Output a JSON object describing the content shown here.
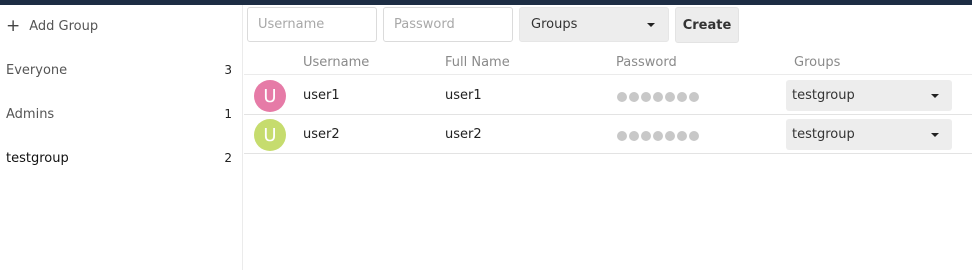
{
  "sidebar": {
    "add_group_icon": "+",
    "add_group_label": "Add Group",
    "groups": [
      {
        "name": "Everyone",
        "count": "3"
      },
      {
        "name": "Admins",
        "count": "1"
      },
      {
        "name": "testgroup",
        "count": "2"
      }
    ]
  },
  "toolbar": {
    "username_placeholder": "Username",
    "password_placeholder": "Password",
    "groups_select": "Groups",
    "create_label": "Create"
  },
  "table": {
    "headers": {
      "username": "Username",
      "fullname": "Full Name",
      "password": "Password",
      "groups": "Groups"
    },
    "rows": [
      {
        "avatar_letter": "U",
        "avatar_color": "#e67ba7",
        "username": "user1",
        "fullname": "user1",
        "password_dots": 7,
        "groups": "testgroup"
      },
      {
        "avatar_letter": "U",
        "avatar_color": "#c6dc6e",
        "username": "user2",
        "fullname": "user2",
        "password_dots": 7,
        "groups": "testgroup"
      }
    ]
  },
  "colors": {
    "header_bar": "#1d2d44"
  }
}
